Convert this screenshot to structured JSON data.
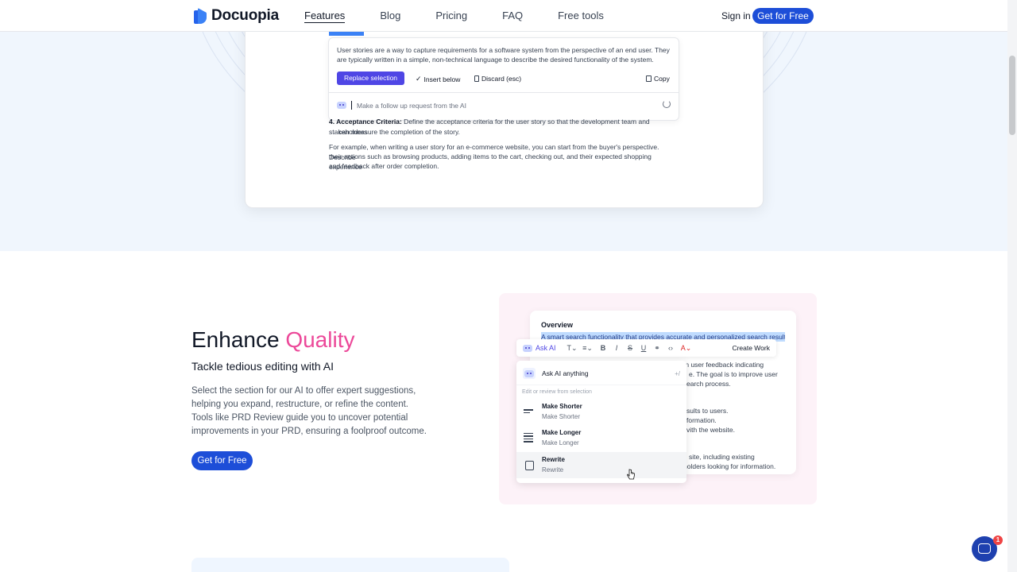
{
  "nav": {
    "brand": "Docuopia",
    "links": [
      "Features",
      "Blog",
      "Pricing",
      "FAQ",
      "Free tools"
    ],
    "signin": "Sign in",
    "cta": "Get for Free"
  },
  "top_demo": {
    "popup_text": "User stories are a way to capture requirements for a software system from the perspective of an end user. They are typically written in a simple, non-technical language to describe the desired functionality of the system.",
    "replace_label": "Replace selection",
    "insert_label": "Insert below",
    "discard_label": "Discard (esc)",
    "copy_label": "Copy",
    "followup_placeholder": "Make a follow up request from the AI",
    "criteria_bold": "4. Acceptance Criteria:",
    "criteria_text": " Define the acceptance criteria for the user story so that the development team and stakeholders",
    "criteria_text2": "can measure the completion of the story.",
    "example_1": "For example, when writing a user story for an e-commerce website, you can start from the buyer's perspective. Describe",
    "example_2": "their actions such as browsing products, adding items to the cart, checking out, and their expected shopping experience",
    "example_3": "and feedback after order completion."
  },
  "enhance": {
    "title_plain": "Enhance ",
    "title_accent": "Quality",
    "subtitle": "Tackle tedious editing with AI",
    "desc_1": "Select the section for our AI to offer expert suggestions, helping you expand, restructure, or refine the content.",
    "desc_2": "Tools like PRD Review guide you to uncover potential improvements in your PRD, ensuring a foolproof outcome.",
    "cta": "Get for Free"
  },
  "mock": {
    "overview": "Overview",
    "highlight": "A smart search functionality that provides accurate and personalized search results",
    "lines": [
      "m user feedback indicating",
      "e. The goal is to improve user",
      "earch process.",
      "sults to users.",
      "formation.",
      "vith the website.",
      "site, including existing",
      "holders looking for information."
    ],
    "toolbar": {
      "ask_ai": "Ask AI",
      "create_work": "Create Work"
    },
    "menu": {
      "ask_anything": "Ask AI anything",
      "shortcut": "+/",
      "hint": "Edit or review from selection",
      "items": [
        {
          "title": "Make Shorter",
          "sub": "Make Shorter"
        },
        {
          "title": "Make Longer",
          "sub": "Make Longer"
        },
        {
          "title": "Rewrite",
          "sub": "Rewrite"
        }
      ]
    }
  },
  "chat": {
    "badge": "1"
  },
  "colors": {
    "primary": "#1d4ed8",
    "accent": "#ec4899",
    "section_bg": "#f0f6fd"
  },
  "icons": [
    "logo-icon",
    "checkmark-icon",
    "trash-icon",
    "copy-icon",
    "ai-bot-icon",
    "refresh-icon",
    "text-format-icon",
    "align-icon",
    "bold-icon",
    "italic-icon",
    "strike-icon",
    "underline-icon",
    "link-icon",
    "code-icon",
    "font-color-icon",
    "lines-icon",
    "rewrite-icon",
    "pointer-cursor-icon",
    "chat-icon"
  ]
}
